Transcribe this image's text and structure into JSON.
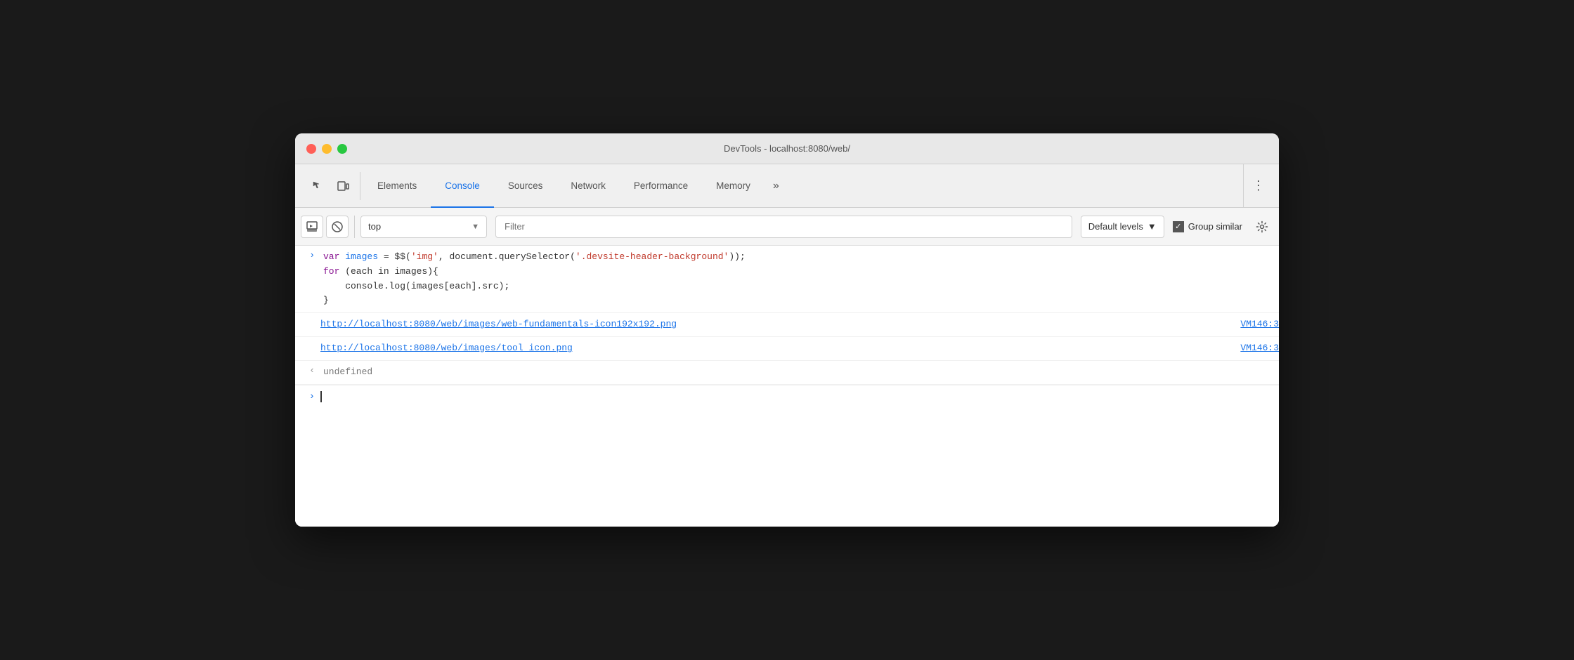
{
  "window": {
    "title": "DevTools - localhost:8080/web/"
  },
  "tabs": {
    "items": [
      {
        "id": "elements",
        "label": "Elements",
        "active": false
      },
      {
        "id": "console",
        "label": "Console",
        "active": true
      },
      {
        "id": "sources",
        "label": "Sources",
        "active": false
      },
      {
        "id": "network",
        "label": "Network",
        "active": false
      },
      {
        "id": "performance",
        "label": "Performance",
        "active": false
      },
      {
        "id": "memory",
        "label": "Memory",
        "active": false
      }
    ],
    "overflow_label": "»",
    "more_label": "⋮"
  },
  "toolbar": {
    "context_value": "top",
    "filter_placeholder": "Filter",
    "levels_label": "Default levels",
    "group_similar_label": "Group similar"
  },
  "console": {
    "entries": [
      {
        "arrow": "›",
        "arrow_color": "blue",
        "type": "code",
        "lines": [
          "var images = $$('img', document.querySelector('.devsite-header-background'));",
          "for (each in images){",
          "    console.log(images[each].src);",
          "}"
        ]
      },
      {
        "arrow": "",
        "arrow_color": "none",
        "type": "link",
        "url": "http://localhost:8080/web/images/web-fundamentals-icon192x192.png",
        "ref": "VM146:3"
      },
      {
        "arrow": "",
        "arrow_color": "none",
        "type": "link",
        "url": "http://localhost:8080/web/images/tool_icon.png",
        "ref": "VM146:3"
      },
      {
        "arrow": "‹",
        "arrow_color": "gray",
        "type": "undefined",
        "text": "undefined"
      }
    ],
    "input_caret": "›"
  }
}
